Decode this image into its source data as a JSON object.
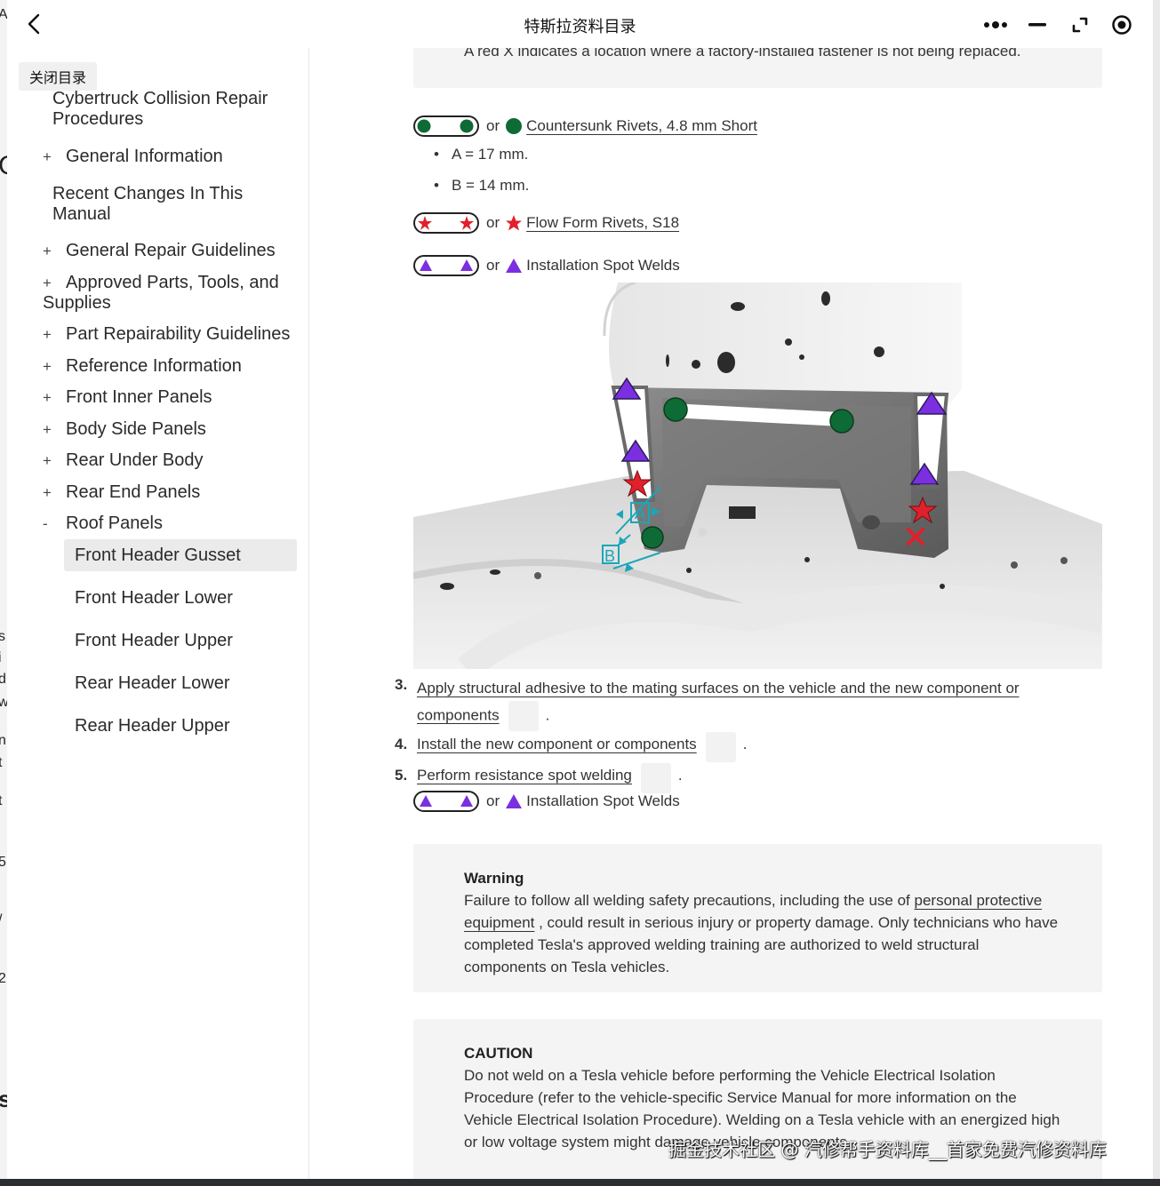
{
  "window": {
    "title": "特斯拉资料目录"
  },
  "left_edge_fragments": [
    "A",
    "C",
    "s",
    "i",
    "d",
    "w",
    "n",
    "t",
    "t",
    "5",
    "/",
    "2",
    "s"
  ],
  "sidebar": {
    "close_label": "关闭目录",
    "top_heading": "Cybertruck Collision Repair Procedures",
    "items": [
      {
        "sign": "+",
        "label": "General Information"
      },
      {
        "sign": "",
        "label": "Recent Changes In This Manual"
      },
      {
        "sign": "+",
        "label": "General Repair Guidelines"
      },
      {
        "sign": "+",
        "label": "Approved Parts, Tools, and Supplies"
      },
      {
        "sign": "+",
        "label": "Part Repairability Guidelines"
      },
      {
        "sign": "+",
        "label": "Reference Information"
      },
      {
        "sign": "+",
        "label": "Front Inner Panels"
      },
      {
        "sign": "+",
        "label": "Body Side Panels"
      },
      {
        "sign": "+",
        "label": "Rear Under Body"
      },
      {
        "sign": "+",
        "label": "Rear End Panels"
      },
      {
        "sign": "-",
        "label": "Roof Panels"
      }
    ],
    "sub_items": [
      "Front Header Gusset",
      "Front Header Lower",
      "Front Header Upper",
      "Rear Header Lower",
      "Rear Header Upper"
    ],
    "active_sub": "Front Header Gusset"
  },
  "content": {
    "top_note": "A red X indicates a location where a factory-installed fastener is not being replaced.",
    "legend": {
      "or": "or",
      "rivets": "Countersunk Rivets, 4.8 mm Short",
      "bullet_a": "A = 17 mm.",
      "bullet_b": "B = 14 mm.",
      "flow_form": "Flow Form Rivets, S18",
      "spot_welds": "Installation Spot Welds"
    },
    "figure_labels": {
      "a": "A",
      "b": "B"
    },
    "steps": [
      {
        "num": "3.",
        "text_1": "Apply structural adhesive to the mating surfaces on the vehicle and the new component or",
        "text_2": "components",
        "end": "."
      },
      {
        "num": "4.",
        "text": "Install the new component or components",
        "end": "."
      },
      {
        "num": "5.",
        "text": "Perform resistance spot welding",
        "end": "."
      }
    ],
    "warning": {
      "title": "Warning",
      "text_1": "Failure to follow all welding safety precautions, including the use of ",
      "link": "personal protective equipment",
      "text_2": " , could result in serious injury or property damage. Only technicians who have completed Tesla's approved welding training are authorized to weld structural components on Tesla vehicles."
    },
    "caution": {
      "title": "CAUTION",
      "text": "Do not weld on a Tesla vehicle before performing the Vehicle Electrical Isolation Procedure (refer to the vehicle-specific Service Manual for more information on the Vehicle Electrical Isolation Procedure). Welding on a Tesla vehicle with an energized high or low voltage system might damage vehicle components."
    }
  },
  "watermark": "掘金技术社区 @ 汽修帮手资料库__首家免费汽修资料库",
  "colors": {
    "rivet_green": "#0f6b35",
    "star_red": "#e0202a",
    "triangle_purple": "#7b2fe0",
    "dimension_cyan": "#1aa6b8"
  }
}
